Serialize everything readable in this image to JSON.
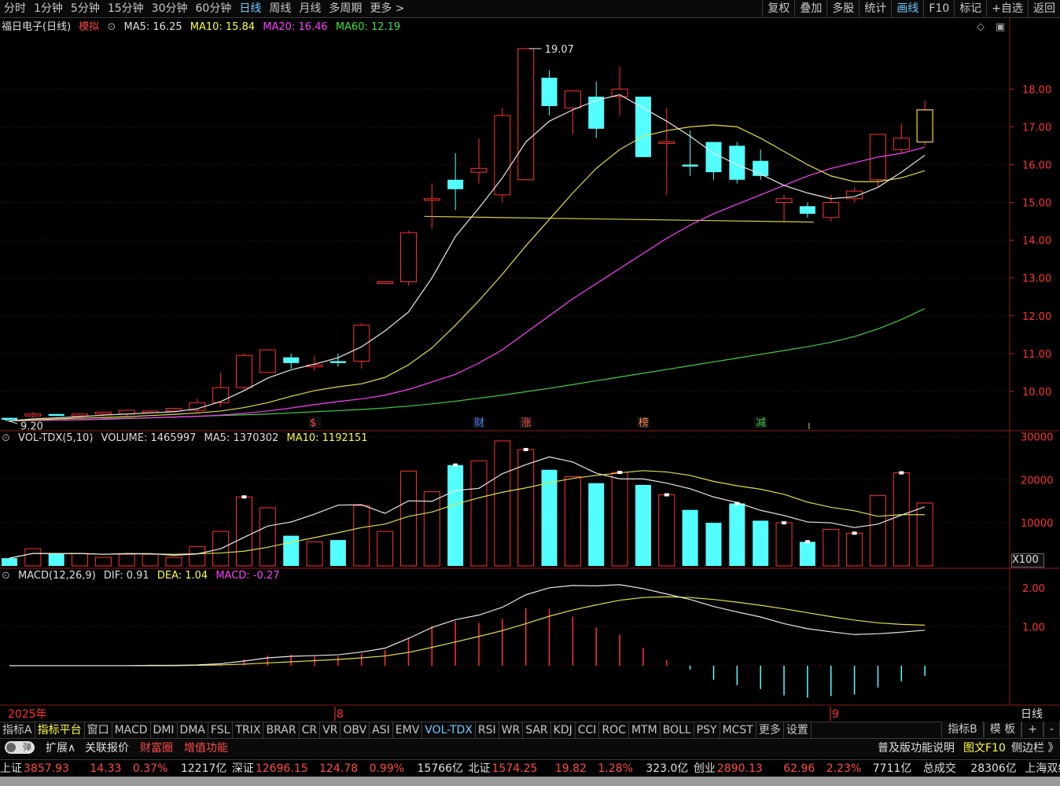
{
  "toolbar": {
    "periods": [
      "分时",
      "1分钟",
      "5分钟",
      "15分钟",
      "30分钟",
      "60分钟",
      "日线",
      "周线",
      "月线",
      "多周期",
      "更多 >"
    ],
    "active_period": "日线",
    "tools": [
      "复权",
      "叠加",
      "多股",
      "统计",
      "画线",
      "F10",
      "标记",
      "+自选",
      "返回"
    ],
    "active_tool": "画线"
  },
  "main_panel": {
    "stock_name": "福日电子(日线)",
    "mode_label": "模拟",
    "ma5": "MA5: 16.25",
    "ma10": "MA10: 15.84",
    "ma20": "MA20: 16.46",
    "ma60": "MA60: 12.19",
    "high_label": "19.07",
    "low_label": "9.20",
    "price_ticks": [
      "18.00",
      "17.00",
      "16.00",
      "15.00",
      "14.00",
      "13.00",
      "12.00",
      "11.00",
      "10.00"
    ],
    "event_markers": [
      "$",
      "财",
      "涨",
      "榜",
      "减"
    ]
  },
  "volume_panel": {
    "indicator": "VOL-TDX(5,10)",
    "volume": "VOLUME: 1465997",
    "ma5": "MA5: 1370302",
    "ma10": "MA10: 1192151",
    "ticks": [
      "30000",
      "20000",
      "10000"
    ],
    "multiplier": "X100"
  },
  "macd_panel": {
    "indicator": "MACD(12,26,9)",
    "dif": "DIF: 0.91",
    "dea": "DEA: 1.04",
    "macd": "MACD: -0.27",
    "ticks": [
      "2.00",
      "1.00"
    ]
  },
  "date_axis": {
    "year": "2025年",
    "month1": "8",
    "month2": "9",
    "period_label": "日线"
  },
  "bottom_tabs": [
    "指标A",
    "指标平台",
    "窗口",
    "MACD",
    "DMI",
    "DMA",
    "FSL",
    "TRIX",
    "BRAR",
    "CR",
    "VR",
    "OBV",
    "ASI",
    "EMV",
    "VOL-TDX",
    "RSI",
    "WR",
    "SAR",
    "KDJ",
    "CCI",
    "ROC",
    "MTM",
    "BOLL",
    "PSY",
    "MCST",
    "更多",
    "设置"
  ],
  "active_tab": "VOL-TDX",
  "bottom_right_tabs": [
    "指标B",
    "模 板",
    "+",
    "-"
  ],
  "toolbar2": {
    "toggle": "弹",
    "expand": "扩展∧",
    "quote": "关联报价",
    "wealth": "财富圈",
    "addon": "增值功能",
    "help": "普及版功能说明",
    "f10": "图文F10",
    "sidebar": "侧边栏 》"
  },
  "ticker": {
    "sh_label": "上证",
    "sh_value": "3857.93",
    "sh_change": "14.33",
    "sh_pct": "0.37%",
    "sh_amount": "12217亿",
    "sz_label": "深证",
    "sz_value": "12696.15",
    "sz_change": "124.78",
    "sz_pct": "0.99%",
    "sz_amount": "15766亿",
    "bz_label": "北证",
    "bz_value": "1574.25",
    "bz_change": "19.82",
    "bz_pct": "1.28%",
    "bz_amount": "323.0亿",
    "cy_label": "创业",
    "cy_value": "2890.13",
    "cy_change": "62.96",
    "cy_pct": "2.23%",
    "cy_amount": "7711亿",
    "total_label": "总成交",
    "total_value": "28306亿",
    "mode": "上海双线"
  },
  "chart_data": {
    "type": "candlestick",
    "candles": [
      [
        9.3,
        9.3,
        9.2,
        9.25
      ],
      [
        9.35,
        9.45,
        9.3,
        9.4
      ],
      [
        9.4,
        9.4,
        9.35,
        9.35
      ],
      [
        9.35,
        9.4,
        9.3,
        9.4
      ],
      [
        9.4,
        9.45,
        9.35,
        9.45
      ],
      [
        9.4,
        9.5,
        9.35,
        9.5
      ],
      [
        9.45,
        9.5,
        9.42,
        9.48
      ],
      [
        9.48,
        9.55,
        9.45,
        9.55
      ],
      [
        9.5,
        9.8,
        9.45,
        9.7
      ],
      [
        9.7,
        10.5,
        9.6,
        10.1
      ],
      [
        10.1,
        11.0,
        10.05,
        10.95
      ],
      [
        10.5,
        11.1,
        10.5,
        11.1
      ],
      [
        10.9,
        11.0,
        10.6,
        10.75
      ],
      [
        10.65,
        10.95,
        10.55,
        10.7
      ],
      [
        10.8,
        11.0,
        10.65,
        10.75
      ],
      [
        10.8,
        11.8,
        10.6,
        11.75
      ],
      [
        12.9,
        12.92,
        12.85,
        12.9
      ],
      [
        12.9,
        14.25,
        12.8,
        14.2
      ],
      [
        15.1,
        15.5,
        14.3,
        15.1
      ],
      [
        15.6,
        16.3,
        14.8,
        15.35
      ],
      [
        15.8,
        16.7,
        15.5,
        15.9
      ],
      [
        15.2,
        17.5,
        15.0,
        17.3
      ],
      [
        15.6,
        19.07,
        16.85,
        19.07
      ],
      [
        18.3,
        18.5,
        17.3,
        17.55
      ],
      [
        17.5,
        17.9,
        16.8,
        17.95
      ],
      [
        17.8,
        18.2,
        16.7,
        16.95
      ],
      [
        17.8,
        18.6,
        17.3,
        18.0
      ],
      [
        17.8,
        17.7,
        16.2,
        16.2
      ],
      [
        16.6,
        17.5,
        15.2,
        16.6
      ],
      [
        16.0,
        16.9,
        15.7,
        15.95
      ],
      [
        16.6,
        16.5,
        15.6,
        15.8
      ],
      [
        16.5,
        16.6,
        15.5,
        15.6
      ],
      [
        16.1,
        16.4,
        15.6,
        15.7
      ],
      [
        15.0,
        15.2,
        14.5,
        15.1
      ],
      [
        14.9,
        15.0,
        14.6,
        14.7
      ],
      [
        14.6,
        15.2,
        14.5,
        15.0
      ],
      [
        15.1,
        15.4,
        15.0,
        15.3
      ],
      [
        15.6,
        16.8,
        15.4,
        16.8
      ],
      [
        16.4,
        17.1,
        16.3,
        16.7
      ],
      [
        16.6,
        17.7,
        16.5,
        17.45
      ]
    ],
    "ma5": [
      9.22,
      9.27,
      9.3,
      9.33,
      9.37,
      9.4,
      9.43,
      9.46,
      9.54,
      9.73,
      10.02,
      10.35,
      10.57,
      10.72,
      10.89,
      11.18,
      11.6,
      12.1,
      13.0,
      14.1,
      14.85,
      15.65,
      16.6,
      17.15,
      17.45,
      17.7,
      17.85,
      17.5,
      17.15,
      16.75,
      16.3,
      16.0,
      15.75,
      15.45,
      15.25,
      15.1,
      15.15,
      15.4,
      15.8,
      16.25
    ],
    "ma10": [
      9.22,
      9.24,
      9.27,
      9.29,
      9.31,
      9.33,
      9.36,
      9.39,
      9.43,
      9.48,
      9.57,
      9.7,
      9.87,
      10.02,
      10.12,
      10.2,
      10.37,
      10.7,
      11.15,
      11.75,
      12.4,
      13.1,
      13.85,
      14.55,
      15.25,
      15.9,
      16.4,
      16.75,
      16.9,
      17.0,
      17.05,
      17.0,
      16.7,
      16.35,
      16.0,
      15.7,
      15.55,
      15.55,
      15.65,
      15.84
    ],
    "ma20": [
      9.22,
      9.23,
      9.24,
      9.25,
      9.27,
      9.29,
      9.3,
      9.32,
      9.34,
      9.37,
      9.42,
      9.48,
      9.56,
      9.65,
      9.73,
      9.8,
      9.9,
      10.05,
      10.25,
      10.45,
      10.75,
      11.1,
      11.55,
      12.0,
      12.45,
      12.85,
      13.25,
      13.65,
      14.05,
      14.4,
      14.7,
      14.95,
      15.2,
      15.45,
      15.7,
      15.9,
      16.05,
      16.2,
      16.3,
      16.46
    ],
    "ma60": [
      9.22,
      9.23,
      9.24,
      9.25,
      9.26,
      9.28,
      9.3,
      9.32,
      9.34,
      9.36,
      9.38,
      9.4,
      9.43,
      9.46,
      9.49,
      9.52,
      9.56,
      9.61,
      9.67,
      9.74,
      9.82,
      9.9,
      9.99,
      10.08,
      10.18,
      10.28,
      10.38,
      10.48,
      10.58,
      10.68,
      10.78,
      10.88,
      10.98,
      11.08,
      11.18,
      11.3,
      11.45,
      11.65,
      11.9,
      12.19
    ],
    "volume": [
      1800,
      4000,
      2800,
      2900,
      2000,
      2700,
      2700,
      2000,
      4500,
      8000,
      16000,
      13500,
      7000,
      5600,
      6000,
      14000,
      8000,
      22000,
      17200,
      23400,
      24400,
      29000,
      27000,
      22300,
      20700,
      19200,
      21700,
      18800,
      16500,
      13000,
      10000,
      14500,
      10500,
      10000,
      5600,
      8500,
      7600,
      16300,
      21600,
      14600
    ],
    "volume_ma5": [
      1800,
      2900,
      2867,
      2875,
      2700,
      2880,
      2860,
      2460,
      2780,
      3980,
      6640,
      9240,
      10200,
      12020,
      14100,
      14200,
      12200,
      15100,
      15000,
      17480,
      18000,
      21400,
      23500,
      25300,
      24100,
      21500,
      20200,
      20200,
      19200,
      17900,
      16000,
      14700,
      12900,
      11700,
      10200,
      10000,
      8900,
      9700,
      11800,
      13700
    ],
    "volume_ma10": [
      1800,
      2900,
      2867,
      2875,
      2700,
      2790,
      2785,
      2685,
      2820,
      3000,
      3420,
      4320,
      5500,
      6560,
      7700,
      8900,
      9700,
      11500,
      12500,
      14300,
      15800,
      17100,
      18100,
      19300,
      20300,
      21000,
      21600,
      22100,
      21800,
      21000,
      19600,
      18600,
      17800,
      16600,
      14800,
      13600,
      12800,
      11500,
      11900,
      11900
    ],
    "dif": [
      0,
      0,
      0,
      0,
      0,
      0,
      0.01,
      0.01,
      0.02,
      0.05,
      0.12,
      0.2,
      0.24,
      0.26,
      0.28,
      0.35,
      0.45,
      0.7,
      0.98,
      1.18,
      1.3,
      1.5,
      1.82,
      2.0,
      2.06,
      2.05,
      2.08,
      1.98,
      1.84,
      1.7,
      1.52,
      1.38,
      1.25,
      1.08,
      0.95,
      0.87,
      0.8,
      0.82,
      0.86,
      0.91
    ],
    "dea": [
      0,
      0,
      0,
      0,
      0,
      0,
      0,
      0,
      0.01,
      0.02,
      0.04,
      0.07,
      0.1,
      0.13,
      0.16,
      0.2,
      0.25,
      0.34,
      0.47,
      0.61,
      0.75,
      0.9,
      1.08,
      1.27,
      1.43,
      1.56,
      1.68,
      1.75,
      1.77,
      1.75,
      1.7,
      1.63,
      1.55,
      1.46,
      1.36,
      1.26,
      1.17,
      1.1,
      1.06,
      1.04
    ],
    "price_ylim": [
      9.0,
      19.4
    ],
    "volume_ylim": [
      0,
      31000
    ],
    "macd_ylim": [
      -0.95,
      2.4
    ]
  }
}
